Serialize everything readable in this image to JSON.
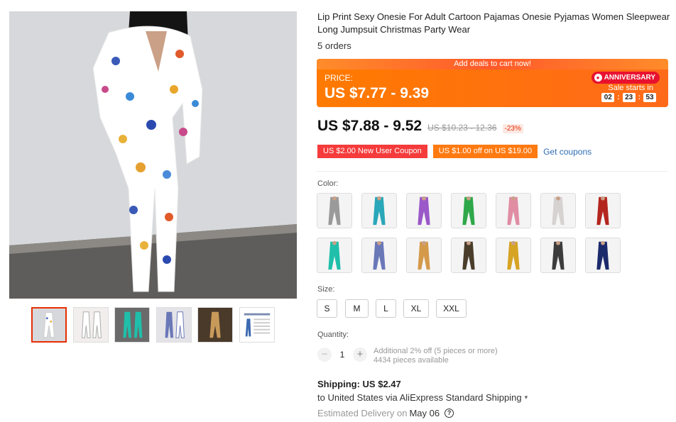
{
  "product": {
    "title": "Lip Print Sexy Onesie For Adult Cartoon Pajamas Onesie Pyjamas Women Sleepwear Long Jumpsuit Christmas Party Wear",
    "orders": "5 orders"
  },
  "deal": {
    "top_text": "Add deals to cart now!",
    "price_label": "PRICE:",
    "price": "US $7.77 - 9.39",
    "badge": "ANNIVERSARY",
    "sale_starts": "Sale starts in",
    "countdown": [
      "02",
      "23",
      "53"
    ],
    "color_brand": "#ff7a00"
  },
  "pricing": {
    "current": "US $7.88 - 9.52",
    "original": "US $10.23 - 12.36",
    "discount": "-23%"
  },
  "coupons": {
    "new_user": "US $2.00 New User Coupon",
    "off": "US $1.00 off on US $19.00",
    "link": "Get coupons"
  },
  "color": {
    "label": "Color:",
    "swatches": [
      {
        "name": "grey-print",
        "color": "#9a9a9a"
      },
      {
        "name": "teal-print",
        "color": "#2aa7b8"
      },
      {
        "name": "purple-print",
        "color": "#9a58c8"
      },
      {
        "name": "green-print",
        "color": "#2fa84a"
      },
      {
        "name": "pink-print",
        "color": "#e08da4"
      },
      {
        "name": "white-print",
        "color": "#d7d2d2"
      },
      {
        "name": "red-print",
        "color": "#b3261e"
      },
      {
        "name": "aqua-print",
        "color": "#1fbfaa"
      },
      {
        "name": "butterfly-print",
        "color": "#6a78b8"
      },
      {
        "name": "floral-print",
        "color": "#d49a4a"
      },
      {
        "name": "black-print",
        "color": "#4a3d2a"
      },
      {
        "name": "mustard",
        "color": "#d6a323"
      },
      {
        "name": "charcoal",
        "color": "#3c3c3c"
      },
      {
        "name": "navy",
        "color": "#1b2a6b"
      }
    ]
  },
  "size": {
    "label": "Size:",
    "options": [
      "S",
      "M",
      "L",
      "XL",
      "XXL"
    ]
  },
  "quantity": {
    "label": "Quantity:",
    "value": "1",
    "minus": "−",
    "plus": "+",
    "additional": "Additional 2% off (5 pieces or more)",
    "available": "4434 pieces available"
  },
  "shipping": {
    "title": "Shipping: US $2.47",
    "to": "to United States via AliExpress Standard Shipping",
    "delivery_label": "Estimated Delivery on",
    "delivery_date": "May 06"
  },
  "gallery": {
    "thumb_colors": [
      "#ffffff",
      "#e9e4e6",
      "#1fbfaa",
      "#6a78b8",
      "#c89a5a",
      "#e9eef2"
    ]
  }
}
